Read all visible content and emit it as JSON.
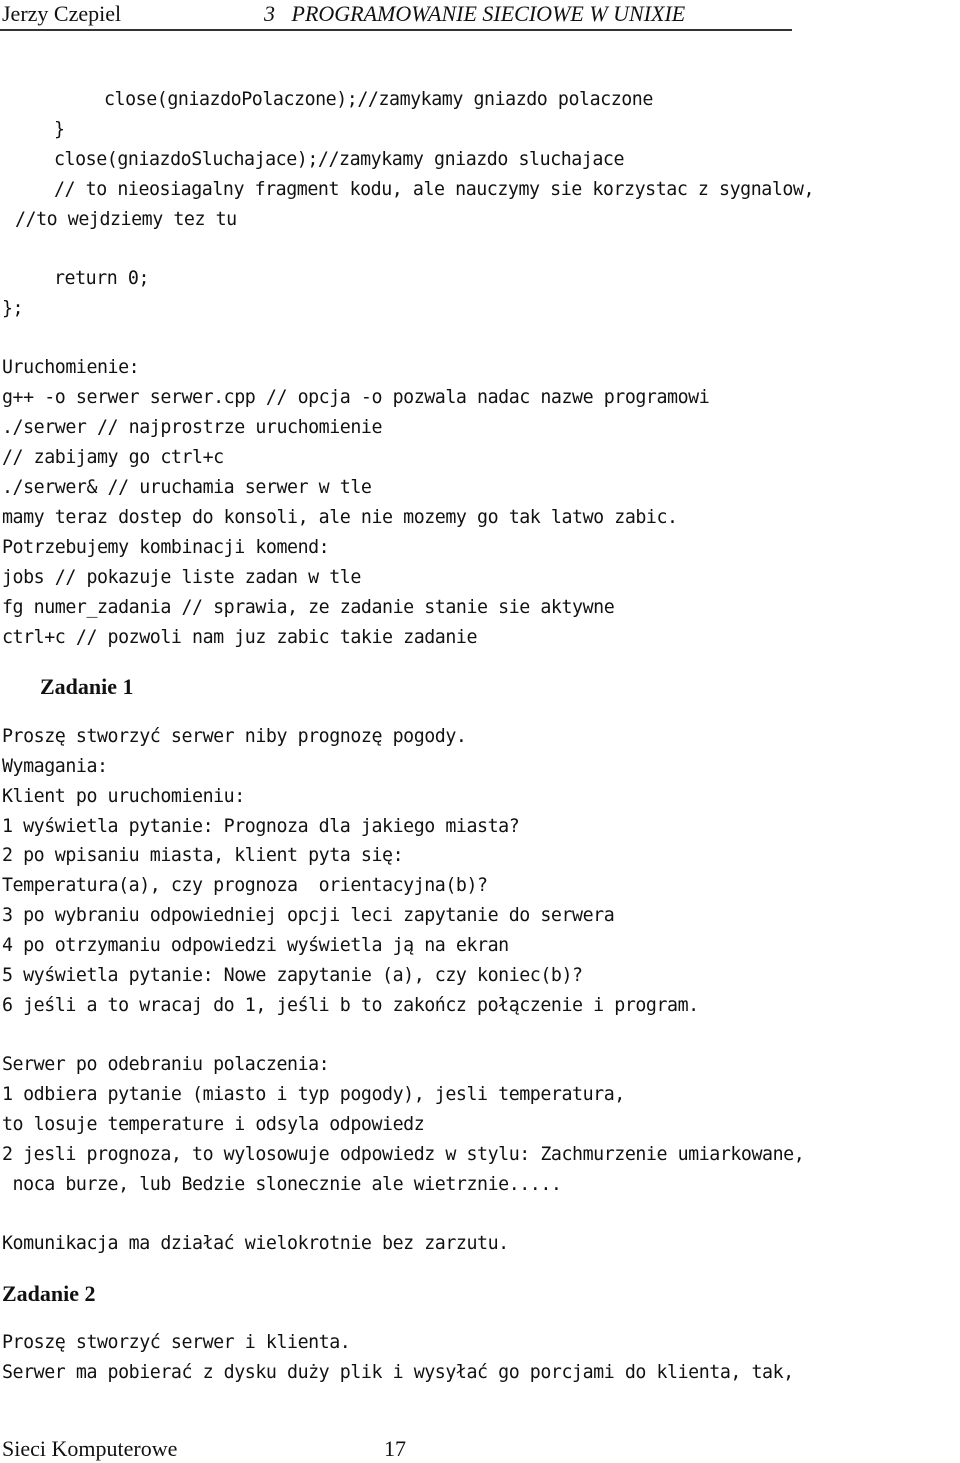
{
  "header": {
    "author": "Jerzy Czepiel",
    "chapter_number": "3",
    "chapter_title": "PROGRAMOWANIE SIECIOWE W UNIXIE"
  },
  "code": {
    "lines": [
      "close(gniazdoPolaczone);//zamykamy gniazdo polaczone",
      "}",
      "close(gniazdoSluchajace);//zamykamy gniazdo sluchajace",
      "// to nieosiagalny fragment kodu, ale nauczymy sie korzystac z sygnalow,",
      "//to wejdziemy tez tu",
      "return 0;",
      "};"
    ]
  },
  "run": {
    "lines": [
      "Uruchomienie:",
      "g++ -o serwer serwer.cpp // opcja -o pozwala nadac nazwe programowi",
      "./serwer // najprostrze uruchomienie",
      "// zabijamy go ctrl+c",
      "./serwer& // uruchamia serwer w tle",
      "mamy teraz dostep do konsoli, ale nie mozemy go tak latwo zabic.",
      "Potrzebujemy kombinacji komend:",
      "jobs // pokazuje liste zadan w tle",
      "fg numer_zadania // sprawia, ze zadanie stanie sie aktywne",
      "ctrl+c // pozwoli nam juz zabic takie zadanie"
    ]
  },
  "task1": {
    "heading": "Zadanie 1",
    "lines": [
      "Proszę stworzyć serwer niby prognozę pogody.",
      "Wymagania:",
      "Klient po uruchomieniu:",
      "1 wyświetla pytanie: Prognoza dla jakiego miasta?",
      "2 po wpisaniu miasta, klient pyta się:",
      "Temperatura(a), czy prognoza  orientacyjna(b)?",
      "3 po wybraniu odpowiedniej opcji leci zapytanie do serwera",
      "4 po otrzymaniu odpowiedzi wyświetla ją na ekran",
      "5 wyświetla pytanie: Nowe zapytanie (a), czy koniec(b)?",
      "6 jeśli a to wracaj do 1, jeśli b to zakończ połączenie i program."
    ],
    "server_lines": [
      "Serwer po odebraniu polaczenia:",
      "1 odbiera pytanie (miasto i typ pogody), jesli temperatura,",
      "to losuje temperature i odsyla odpowiedz",
      "2 jesli prognoza, to wylosowuje odpowiedz w stylu: Zachmurzenie umiarkowane,",
      " noca burze, lub Bedzie slonecznie ale wietrznie....."
    ],
    "closing": "Komunikacja ma działać wielokrotnie bez zarzutu."
  },
  "task2": {
    "heading": "Zadanie 2",
    "lines": [
      "Proszę stworzyć serwer i klienta.",
      "Serwer ma pobierać z dysku duży plik i wysyłać go porcjami do klienta, tak,"
    ]
  },
  "footer": {
    "course": "Sieci Komputerowe",
    "page_number": "17"
  }
}
